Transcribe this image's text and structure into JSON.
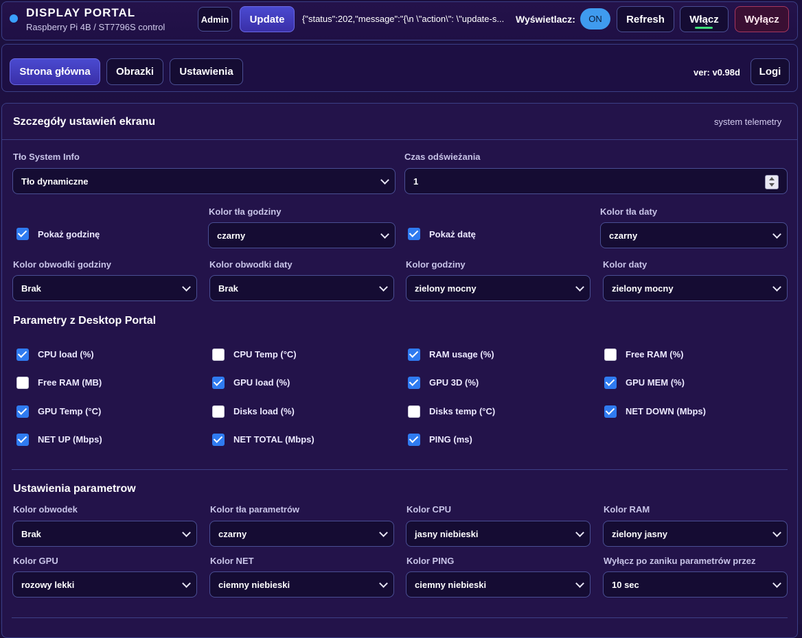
{
  "header": {
    "title": "DISPLAY PORTAL",
    "subtitle": "Raspberry Pi 4B / ST7796S control",
    "admin_label": "Admin",
    "update_label": "Update",
    "status_message": "{\"status\":202,\"message\":\"{\\n \\\"action\\\": \\\"update-s...",
    "display_label": "Wyświetlacz:",
    "display_state": "ON",
    "refresh_label": "Refresh",
    "on_label": "Włącz",
    "off_label": "Wyłącz"
  },
  "nav": {
    "tabs": [
      "Strona główna",
      "Obrazki",
      "Ustawienia"
    ],
    "active_tab": "Strona główna",
    "version": "ver: v0.98d",
    "logs_label": "Logi"
  },
  "panel": {
    "title": "Szczegóły ustawień ekranu",
    "tag": "system telemetry"
  },
  "screen": {
    "bg_label": "Tło System Info",
    "bg_value": "Tło dynamiczne",
    "refresh_label": "Czas odświeżania",
    "refresh_value": "1",
    "show_time_label": "Pokaż godzinę",
    "show_time_checked": true,
    "time_bg_label": "Kolor tła godziny",
    "time_bg_value": "czarny",
    "show_date_label": "Pokaż datę",
    "show_date_checked": true,
    "date_bg_label": "Kolor tła daty",
    "date_bg_value": "czarny",
    "time_outline_label": "Kolor obwodki godziny",
    "time_outline_value": "Brak",
    "date_outline_label": "Kolor obwodki daty",
    "date_outline_value": "Brak",
    "time_color_label": "Kolor godziny",
    "time_color_value": "zielony mocny",
    "date_color_label": "Kolor daty",
    "date_color_value": "zielony mocny"
  },
  "desktop": {
    "title": "Parametry z Desktop Portal",
    "params": [
      {
        "label": "CPU load (%)",
        "checked": true
      },
      {
        "label": "CPU Temp (°C)",
        "checked": false
      },
      {
        "label": "RAM usage (%)",
        "checked": true
      },
      {
        "label": "Free RAM (%)",
        "checked": false
      },
      {
        "label": "Free RAM (MB)",
        "checked": false
      },
      {
        "label": "GPU load (%)",
        "checked": true
      },
      {
        "label": "GPU 3D (%)",
        "checked": true
      },
      {
        "label": "GPU MEM (%)",
        "checked": true
      },
      {
        "label": "GPU Temp (°C)",
        "checked": true
      },
      {
        "label": "Disks load (%)",
        "checked": false
      },
      {
        "label": "Disks temp (°C)",
        "checked": false
      },
      {
        "label": "NET DOWN (Mbps)",
        "checked": true
      },
      {
        "label": "NET UP (Mbps)",
        "checked": true
      },
      {
        "label": "NET TOTAL (Mbps)",
        "checked": true
      },
      {
        "label": "PING (ms)",
        "checked": true
      }
    ]
  },
  "params_settings": {
    "title": "Ustawienia parametrow",
    "fields": [
      {
        "label": "Kolor obwodek",
        "value": "Brak"
      },
      {
        "label": "Kolor tła parametrów",
        "value": "czarny"
      },
      {
        "label": "Kolor CPU",
        "value": "jasny niebieski"
      },
      {
        "label": "Kolor RAM",
        "value": "zielony jasny"
      },
      {
        "label": "Kolor GPU",
        "value": "rozowy lekki"
      },
      {
        "label": "Kolor NET",
        "value": "ciemny niebieski"
      },
      {
        "label": "Kolor PING",
        "value": "ciemny niebieski"
      },
      {
        "label": "Wyłącz po zaniku parametrów przez",
        "value": "10 sec"
      }
    ]
  },
  "colors": {
    "accent": "#3f9bee",
    "checkbox": "#2f7bf0",
    "danger": "#a8375f",
    "panel_bg": "#23134a",
    "border": "#3b3f86"
  }
}
